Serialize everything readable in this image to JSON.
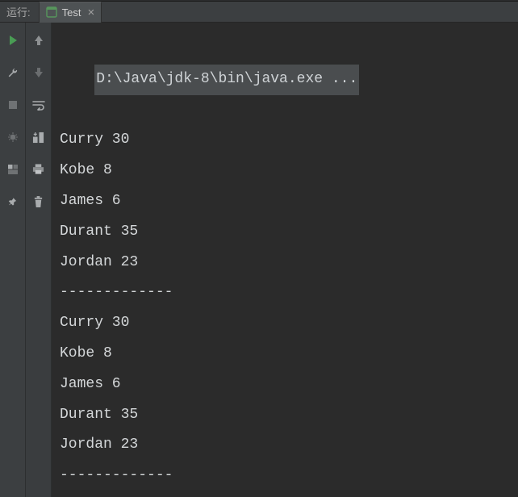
{
  "tabbar": {
    "run_label": "运行:",
    "tab": {
      "label": "Test",
      "close_glyph": "×"
    }
  },
  "gutter_left": {
    "run": "run-icon",
    "wrench": "wrench-icon",
    "stop": "stop-icon",
    "debug": "debug-icon",
    "layout": "layout-icon",
    "pin": "pin-icon"
  },
  "gutter_mid": {
    "up": "arrow-up-icon",
    "down": "arrow-down-icon",
    "wrap": "soft-wrap-icon",
    "scroll": "scroll-to-end-icon",
    "print": "print-icon",
    "trash": "trash-icon"
  },
  "console": {
    "command": "D:\\Java\\jdk-8\\bin\\java.exe ...",
    "lines": [
      "Curry 30",
      "Kobe 8",
      "James 6",
      "Durant 35",
      "Jordan 23",
      "-------------",
      "Curry 30",
      "Kobe 8",
      "James 6",
      "Durant 35",
      "Jordan 23",
      "-------------"
    ]
  }
}
